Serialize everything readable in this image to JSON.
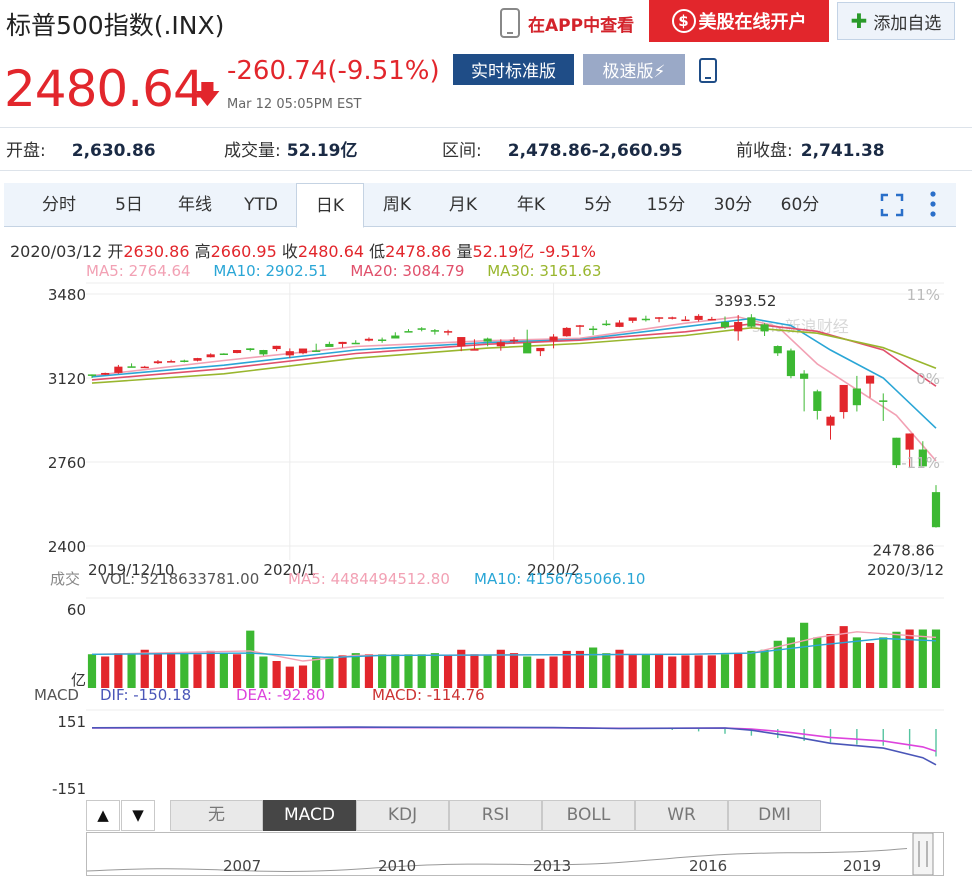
{
  "header": {
    "title": "标普500指数(.INX)",
    "app_label": "在APP中查看",
    "open_label": "美股在线开户",
    "open_icon": "$",
    "add_label": "添加自选",
    "add_icon": "✚"
  },
  "quote": {
    "price": "2480.64",
    "arrow": "🡇",
    "change": "-260.74(-9.51%)",
    "time": "Mar 12 05:05PM EST",
    "realtime_label": "实时标准版",
    "fast_label": "极速版⚡"
  },
  "stats": [
    {
      "label": "开盘:",
      "value": "2,630.86"
    },
    {
      "label": "成交量:",
      "value": "52.19亿"
    },
    {
      "label": "区间:",
      "value": "2,478.86-2,660.95"
    },
    {
      "label": "前收盘:",
      "value": "2,741.38"
    }
  ],
  "tabs": [
    "分时",
    "5日",
    "年线",
    "YTD",
    "日K",
    "周K",
    "月K",
    "年K",
    "5分",
    "15分",
    "30分",
    "60分"
  ],
  "active_tab": "日K",
  "day_info": {
    "date": "2020/03/12",
    "open_label": "开",
    "open": "2630.86",
    "high_label": "高",
    "high": "2660.95",
    "close_label": "收",
    "close": "2480.64",
    "low_label": "低",
    "low": "2478.86",
    "vol_label": "量",
    "vol": "52.19亿",
    "pct": "-9.51%"
  },
  "ma": {
    "ma5": "MA5: 2764.64",
    "ma10": "MA10: 2902.51",
    "ma20": "MA20: 3084.79",
    "ma30": "MA30: 3161.63"
  },
  "vol_info": {
    "label": "成交",
    "vol": "VOL: 5218633781.00",
    "ma5": "MA5: 4484494512.80",
    "ma10": "MA10: 4156785066.10",
    "unit": "亿",
    "tick_top": "60"
  },
  "macd_info": {
    "label": "MACD",
    "dif": "DIF: -150.18",
    "dea": "DEA: -92.80",
    "macd": "MACD: -114.76",
    "tick_top": "151",
    "tick_bottom": "-151"
  },
  "indicator_tabs": [
    "无",
    "MACD",
    "KDJ",
    "RSI",
    "BOLL",
    "WR",
    "DMI"
  ],
  "active_indicator": "MACD",
  "nav_years": [
    "2007",
    "2010",
    "2013",
    "2016",
    "2019"
  ],
  "watermark": "sina新浪财经",
  "colors": {
    "up": "#e2262c",
    "down": "#3cb832",
    "ma5": "#f2a1b4",
    "ma10": "#2aa6d6",
    "ma20": "#e0506b",
    "ma30": "#99b62e",
    "dif": "#4a56b8",
    "dea": "#dd44dd",
    "macd_bar": "#55c4a0"
  },
  "chart_data": {
    "type": "candlestick",
    "title": "标普500指数(.INX)",
    "yticks": [
      2400,
      2760,
      3120,
      3480
    ],
    "ylim": [
      2400,
      3480
    ],
    "right_ticks": [
      "11%",
      "0%",
      "-11%"
    ],
    "x_labels": [
      {
        "label": "2019/12/10",
        "index": 0
      },
      {
        "label": "2020/1",
        "index": 15
      },
      {
        "label": "2020/2",
        "index": 35
      },
      {
        "label": "2020/3/12",
        "index": 62
      }
    ],
    "high_annotation": {
      "label": "3393.52",
      "value": 3393.52,
      "index": 50
    },
    "low_annotation": {
      "label": "2478.86",
      "value": 2478.86,
      "index": 62
    },
    "ohlc": [
      [
        3135.4,
        3135.4,
        3120.0,
        3132.5
      ],
      [
        3134.0,
        3143.0,
        3133.0,
        3141.6
      ],
      [
        3142.0,
        3176.0,
        3138.0,
        3168.6
      ],
      [
        3170.0,
        3182.7,
        3166.0,
        3168.8
      ],
      [
        3166.0,
        3172.0,
        3165.0,
        3168.5
      ],
      [
        3183.6,
        3197.0,
        3180.0,
        3191.4
      ],
      [
        3192.0,
        3198.2,
        3189.0,
        3192.5
      ],
      [
        3195.0,
        3198.5,
        3187.0,
        3191.1
      ],
      [
        3194.0,
        3206.0,
        3191.0,
        3205.4
      ],
      [
        3209.0,
        3225.6,
        3208.0,
        3221.3
      ],
      [
        3225.0,
        3226.4,
        3221.0,
        3224.0
      ],
      [
        3227.0,
        3240.1,
        3226.0,
        3239.9
      ],
      [
        3247.0,
        3247.9,
        3234.0,
        3240.0
      ],
      [
        3240.0,
        3240.5,
        3216.0,
        3221.3
      ],
      [
        3244.0,
        3258.1,
        3235.0,
        3257.9
      ],
      [
        3217.0,
        3246.8,
        3206.0,
        3234.9
      ],
      [
        3226.0,
        3246.2,
        3222.0,
        3246.3
      ],
      [
        3238.0,
        3267.1,
        3236.0,
        3237.2
      ],
      [
        3266.0,
        3275.6,
        3263.0,
        3253.1
      ],
      [
        3266.0,
        3275.0,
        3250.0,
        3274.7
      ],
      [
        3271.0,
        3282.0,
        3267.0,
        3265.4
      ],
      [
        3280.0,
        3294.0,
        3277.0,
        3288.1
      ],
      [
        3285.0,
        3293.2,
        3271.0,
        3283.2
      ],
      [
        3302.0,
        3316.0,
        3300.0,
        3289.3
      ],
      [
        3321.0,
        3329.7,
        3320.0,
        3316.8
      ],
      [
        3333.0,
        3337.8,
        3320.0,
        3329.6
      ],
      [
        3325.0,
        3329.9,
        3306.0,
        3321.8
      ],
      [
        3318.0,
        3326.9,
        3303.0,
        3320.8
      ],
      [
        3255.0,
        3282.2,
        3235.0,
        3295.5
      ],
      [
        3243.0,
        3285.9,
        3242.0,
        3243.6
      ],
      [
        3289.0,
        3293.0,
        3256.0,
        3276.2
      ],
      [
        3256.0,
        3285.9,
        3237.0,
        3273.4
      ],
      [
        3282.0,
        3295.2,
        3266.0,
        3283.7
      ],
      [
        3271.0,
        3327.1,
        3262.0,
        3225.5
      ],
      [
        3235.0,
        3236.0,
        3214.0,
        3248.9
      ],
      [
        3280.0,
        3308.0,
        3247.0,
        3297.6
      ],
      [
        3299.0,
        3338.0,
        3297.0,
        3334.7
      ],
      [
        3344.0,
        3347.4,
        3306.0,
        3345.8
      ],
      [
        3332.0,
        3343.2,
        3304.0,
        3327.7
      ],
      [
        3353.0,
        3367.5,
        3343.0,
        3352.1
      ],
      [
        3339.0,
        3367.4,
        3338.0,
        3357.8
      ],
      [
        3365.0,
        3376.0,
        3356.0,
        3379.5
      ],
      [
        3374.0,
        3387.1,
        3362.0,
        3373.9
      ],
      [
        3378.0,
        3381.0,
        3359.0,
        3380.2
      ],
      [
        3375.0,
        3383.0,
        3371.0,
        3380.1
      ],
      [
        3365.0,
        3385.0,
        3370.0,
        3370.3
      ],
      [
        3369.0,
        3393.5,
        3362.0,
        3386.2
      ],
      [
        3372.0,
        3382.0,
        3370.0,
        3373.2
      ],
      [
        3360.0,
        3383.5,
        3330.0,
        3337.8
      ],
      [
        3320.0,
        3390.0,
        3280.0,
        3360.0
      ],
      [
        3380.0,
        3393.5,
        3335.0,
        3340.0
      ],
      [
        3350.0,
        3355.0,
        3300.0,
        3320.0
      ],
      [
        3257.0,
        3259.8,
        3214.6,
        3225.9
      ],
      [
        3238.0,
        3246.0,
        3118.8,
        3128.2
      ],
      [
        3139.0,
        3153.5,
        2977.0,
        3116.4
      ],
      [
        3063.0,
        3070.0,
        2942.0,
        2978.8
      ],
      [
        2916.0,
        2959.7,
        2855.8,
        2954.2
      ],
      [
        2974.0,
        3090.0,
        2946.0,
        3090.2
      ],
      [
        3075.0,
        3129.0,
        2976.6,
        3003.4
      ],
      [
        3096.0,
        3130.0,
        3036.0,
        3130.1
      ],
      [
        3024.0,
        3054.0,
        2936.0,
        3023.9
      ],
      [
        2864.0,
        2863.8,
        2734.4,
        2746.6
      ],
      [
        2813.0,
        2882.6,
        2734.0,
        2882.2
      ],
      [
        2813.5,
        2849.0,
        2761.0,
        2741.4
      ],
      [
        2630.9,
        2660.9,
        2478.9,
        2480.6
      ]
    ],
    "ma_series": [
      {
        "name": "MA5",
        "points": [
          [
            0,
            3130
          ],
          [
            10,
            3195
          ],
          [
            20,
            3255
          ],
          [
            30,
            3280
          ],
          [
            37,
            3290
          ],
          [
            45,
            3355
          ],
          [
            49,
            3382
          ],
          [
            52,
            3340
          ],
          [
            55,
            3180
          ],
          [
            58,
            3070
          ],
          [
            61,
            2960
          ],
          [
            64,
            2765
          ]
        ]
      },
      {
        "name": "MA10",
        "points": [
          [
            0,
            3125
          ],
          [
            10,
            3175
          ],
          [
            20,
            3240
          ],
          [
            30,
            3272
          ],
          [
            37,
            3285
          ],
          [
            45,
            3340
          ],
          [
            50,
            3375
          ],
          [
            53,
            3345
          ],
          [
            56,
            3240
          ],
          [
            60,
            3120
          ],
          [
            64,
            2905
          ]
        ]
      },
      {
        "name": "MA20",
        "points": [
          [
            0,
            3112
          ],
          [
            10,
            3160
          ],
          [
            20,
            3225
          ],
          [
            30,
            3265
          ],
          [
            37,
            3282
          ],
          [
            45,
            3318
          ],
          [
            50,
            3352
          ],
          [
            55,
            3320
          ],
          [
            60,
            3240
          ],
          [
            64,
            3085
          ]
        ]
      },
      {
        "name": "MA30",
        "points": [
          [
            0,
            3098
          ],
          [
            10,
            3138
          ],
          [
            20,
            3205
          ],
          [
            30,
            3248
          ],
          [
            37,
            3268
          ],
          [
            45,
            3302
          ],
          [
            50,
            3335
          ],
          [
            55,
            3312
          ],
          [
            60,
            3250
          ],
          [
            64,
            3162
          ]
        ]
      }
    ],
    "volume": {
      "ylim": [
        0,
        80
      ],
      "values": [
        30,
        28,
        31,
        30,
        34,
        31,
        32,
        31,
        30,
        33,
        31,
        30,
        51,
        28,
        24,
        19,
        20,
        27,
        28,
        29,
        31,
        30,
        30,
        30,
        30,
        30,
        31,
        29,
        34,
        30,
        29,
        34,
        31,
        28,
        26,
        28,
        33,
        33,
        36,
        31,
        34,
        30,
        30,
        30,
        28,
        29,
        29,
        29,
        30,
        31,
        33,
        34,
        42,
        45,
        58,
        45,
        48,
        55,
        45,
        40,
        45,
        50,
        52,
        52,
        52
      ],
      "ma5_points": [
        [
          0,
          30
        ],
        [
          12,
          33
        ],
        [
          16,
          24
        ],
        [
          20,
          29
        ],
        [
          45,
          30
        ],
        [
          50,
          31
        ],
        [
          55,
          45
        ],
        [
          58,
          50
        ],
        [
          64,
          45
        ]
      ],
      "ma10_points": [
        [
          0,
          30
        ],
        [
          12,
          31
        ],
        [
          18,
          27
        ],
        [
          22,
          29
        ],
        [
          45,
          30
        ],
        [
          50,
          31
        ],
        [
          55,
          38
        ],
        [
          60,
          44
        ],
        [
          64,
          42
        ]
      ]
    },
    "macd": {
      "ylim": [
        -180,
        180
      ],
      "dif_points": [
        [
          0,
          5
        ],
        [
          20,
          8
        ],
        [
          35,
          6
        ],
        [
          40,
          2
        ],
        [
          48,
          4
        ],
        [
          50,
          -5
        ],
        [
          53,
          -30
        ],
        [
          56,
          -60
        ],
        [
          60,
          -80
        ],
        [
          63,
          -120
        ],
        [
          64,
          -150
        ]
      ],
      "dea_points": [
        [
          0,
          4
        ],
        [
          20,
          6
        ],
        [
          35,
          5
        ],
        [
          40,
          3
        ],
        [
          48,
          4
        ],
        [
          50,
          0
        ],
        [
          53,
          -15
        ],
        [
          56,
          -35
        ],
        [
          60,
          -50
        ],
        [
          63,
          -75
        ],
        [
          64,
          -93
        ]
      ],
      "bars": [
        [
          44,
          -4
        ],
        [
          46,
          -10
        ],
        [
          48,
          -20
        ],
        [
          50,
          -28
        ],
        [
          52,
          -38
        ],
        [
          54,
          -50
        ],
        [
          56,
          -56
        ],
        [
          58,
          -65
        ],
        [
          60,
          -70
        ],
        [
          62,
          -85
        ],
        [
          64,
          -115
        ]
      ]
    }
  }
}
